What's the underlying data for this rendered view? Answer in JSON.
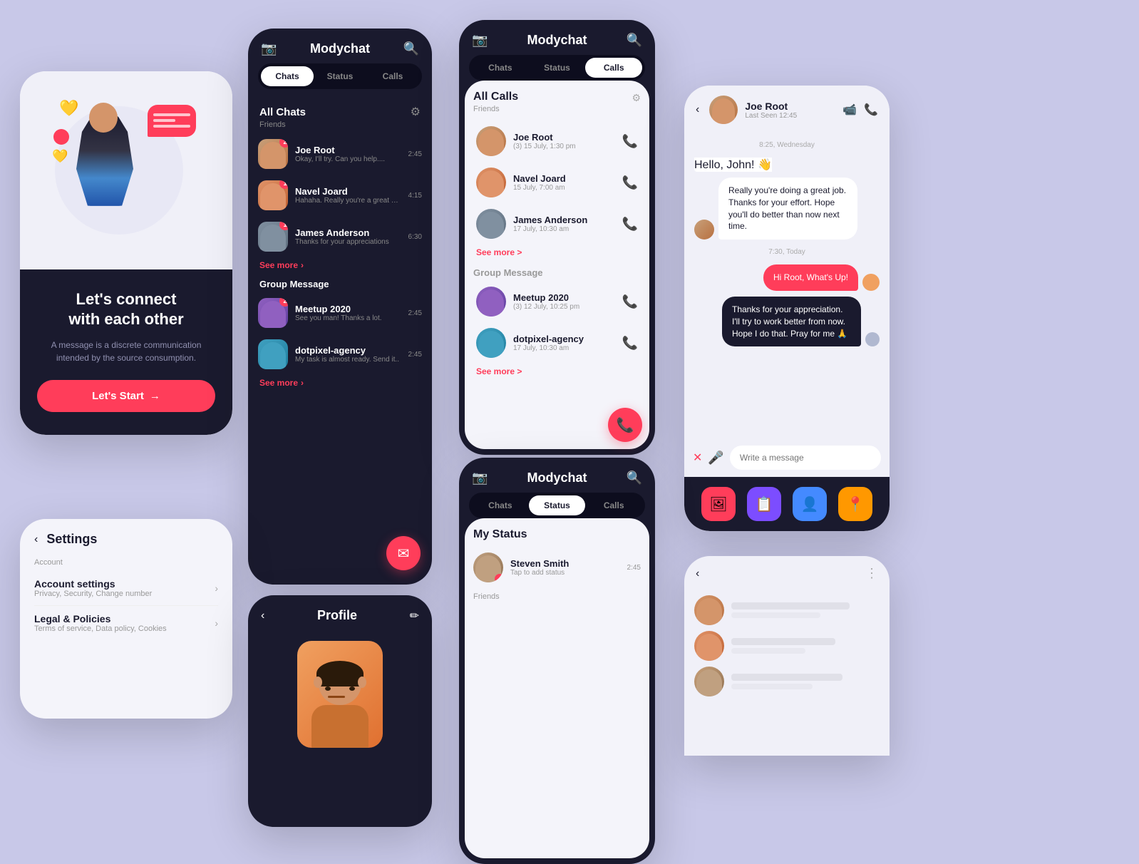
{
  "app": {
    "name": "Modychat",
    "icon": "📷",
    "search_icon": "🔍"
  },
  "onboarding": {
    "title": "Let's connect\nwith each other",
    "description": "A message is a discrete communication intended by the source consumption.",
    "cta_label": "Let's Start",
    "cta_arrow": "→"
  },
  "tabs": {
    "chats": "Chats",
    "status": "Status",
    "calls": "Calls"
  },
  "chats_screen": {
    "section_friends_title": "All Chats",
    "section_friends_sub": "Friends",
    "see_more": "See more",
    "section_group_title": "Group Message",
    "friends": [
      {
        "name": "Joe Root",
        "preview": "Okay, I'll try. Can you help....",
        "time": "2:45",
        "badge": "2"
      },
      {
        "name": "Navel Joard",
        "preview": "Hahaha. Really you're a great person",
        "time": "4:15",
        "badge": "1"
      },
      {
        "name": "James Anderson",
        "preview": "Thanks for your appreciations",
        "time": "6:30",
        "badge": "1"
      }
    ],
    "groups": [
      {
        "name": "Meetup 2020",
        "preview": "See you man! Thanks a lot.",
        "time": "2:45",
        "badge": "2"
      },
      {
        "name": "dotpixel-agency",
        "preview": "My task is almost ready. Send it..",
        "time": "2:45",
        "badge": ""
      }
    ]
  },
  "calls_screen": {
    "section_title": "All Calls",
    "section_sub": "Friends",
    "see_more": "See more >",
    "section_group": "Group Message",
    "friends": [
      {
        "name": "Joe Root",
        "time": "(3) 15 July, 1:30 pm",
        "missed": false
      },
      {
        "name": "Navel Joard",
        "time": "15 July, 7:00 am",
        "missed": false
      },
      {
        "name": "James Anderson",
        "time": "17 July, 10:30 am",
        "missed": true
      }
    ],
    "groups": [
      {
        "name": "Meetup 2020",
        "time": "(3) 12 July, 10:25 pm",
        "missed": false
      },
      {
        "name": "dotpixel-agency",
        "time": "17 July, 10:30 am",
        "missed": false
      }
    ],
    "see_more2": "See more >"
  },
  "chat_detail": {
    "name": "Joe Root",
    "status": "Last Seen 12:45",
    "date_label": "8:25, Wednesday",
    "messages": [
      {
        "type": "received",
        "text": "Hello, John! 👋",
        "sender": "other"
      },
      {
        "type": "received",
        "text": "Really you're doing a great job. Thanks for your effort. Hope you'll do better than now next time.",
        "sender": "other"
      },
      {
        "type": "date",
        "text": "7:30, Today"
      },
      {
        "type": "sent",
        "text": "Hi Root, What's Up!"
      },
      {
        "type": "sent2",
        "text": "Thanks for your appreciation. I'll try to work better from now. Hope I do that. Pray for me 🙏"
      }
    ],
    "input_placeholder": "Write a message",
    "bottom_buttons": [
      "🖼",
      "📋",
      "👤",
      "📍"
    ]
  },
  "settings": {
    "title": "Settings",
    "section": "Account",
    "items": [
      {
        "name": "Account settings",
        "sub": "Privacy, Security, Change number"
      },
      {
        "name": "Legal & Policies",
        "sub": "Terms of service, Data policy, Cookies"
      }
    ]
  },
  "profile": {
    "title": "Profile",
    "back_icon": "←",
    "edit_icon": "✏"
  },
  "status_screen": {
    "my_status_title": "My Status",
    "my_status_user": "Steven Smith",
    "my_status_sub": "Tap to add status",
    "my_status_time": "2:45",
    "section_friends": "Friends"
  }
}
